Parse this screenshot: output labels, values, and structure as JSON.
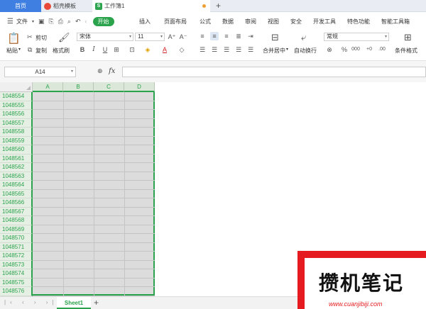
{
  "tabs": [
    {
      "label": "首页"
    },
    {
      "label": "稻壳模板"
    },
    {
      "label": "工作簿1"
    }
  ],
  "menu": {
    "file_label": "文件",
    "start_label": "开始",
    "items": [
      "插入",
      "页面布局",
      "公式",
      "数据",
      "审阅",
      "视图",
      "安全",
      "开发工具",
      "特色功能",
      "智能工具箱"
    ]
  },
  "ribbon": {
    "paste": "粘贴",
    "cut": "剪切",
    "copy": "复制",
    "format_painter": "格式刷",
    "font_name": "宋体",
    "font_size": "11",
    "merge_center": "合并居中",
    "wrap_text": "自动换行",
    "number_format": "常规",
    "conditional_format": "条件格式"
  },
  "formula_bar": {
    "name_box": "A14",
    "fx": "fx",
    "formula": ""
  },
  "grid": {
    "columns": [
      "A",
      "B",
      "C",
      "D"
    ],
    "rows": [
      "1048554",
      "1048555",
      "1048556",
      "1048557",
      "1048558",
      "1048559",
      "1048560",
      "1048561",
      "1048562",
      "1048563",
      "1048564",
      "1048565",
      "1048566",
      "1048567",
      "1048568",
      "1048569",
      "1048570",
      "1048571",
      "1048572",
      "1048573",
      "1048574",
      "1048575",
      "1048576"
    ]
  },
  "sheets": {
    "active": "Sheet1",
    "add": "+"
  },
  "watermark": {
    "text": "攒机笔记",
    "url": "www.cuanjibiji.com"
  },
  "colors": {
    "accent_green": "#2aa34c",
    "home_tab_blue": "#3f7fe1",
    "watermark_red": "#e51b20"
  }
}
